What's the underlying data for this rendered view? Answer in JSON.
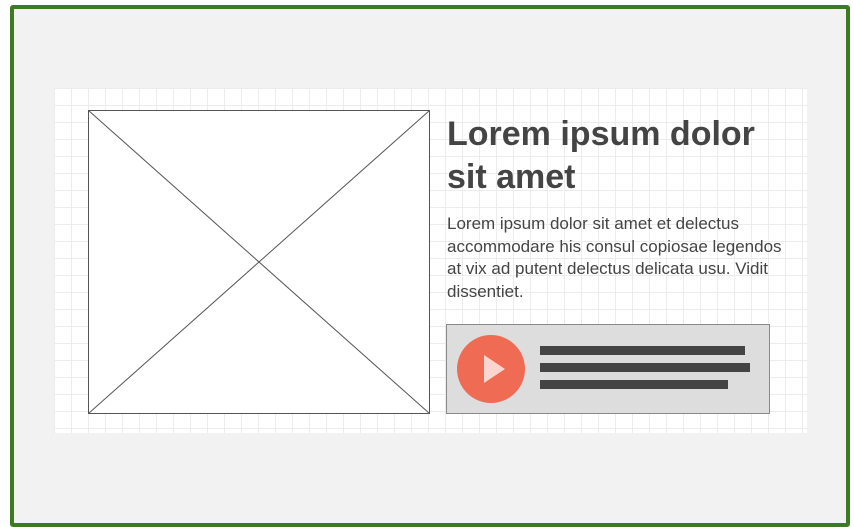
{
  "wireframe": {
    "heading": "Lorem ipsum dolor sit amet",
    "paragraph": "Lorem ipsum dolor sit amet et delectus accommodare his consul copiosae legendos at vix ad putent delectus delicata usu. Vidit dissentiet."
  },
  "icons": {
    "image_placeholder": "image-placeholder-icon",
    "play": "play-icon"
  },
  "colors": {
    "frame_border": "#3e7a22",
    "play_button": "#ef6b54",
    "media_bar": "#dddddd",
    "text": "#444444"
  }
}
